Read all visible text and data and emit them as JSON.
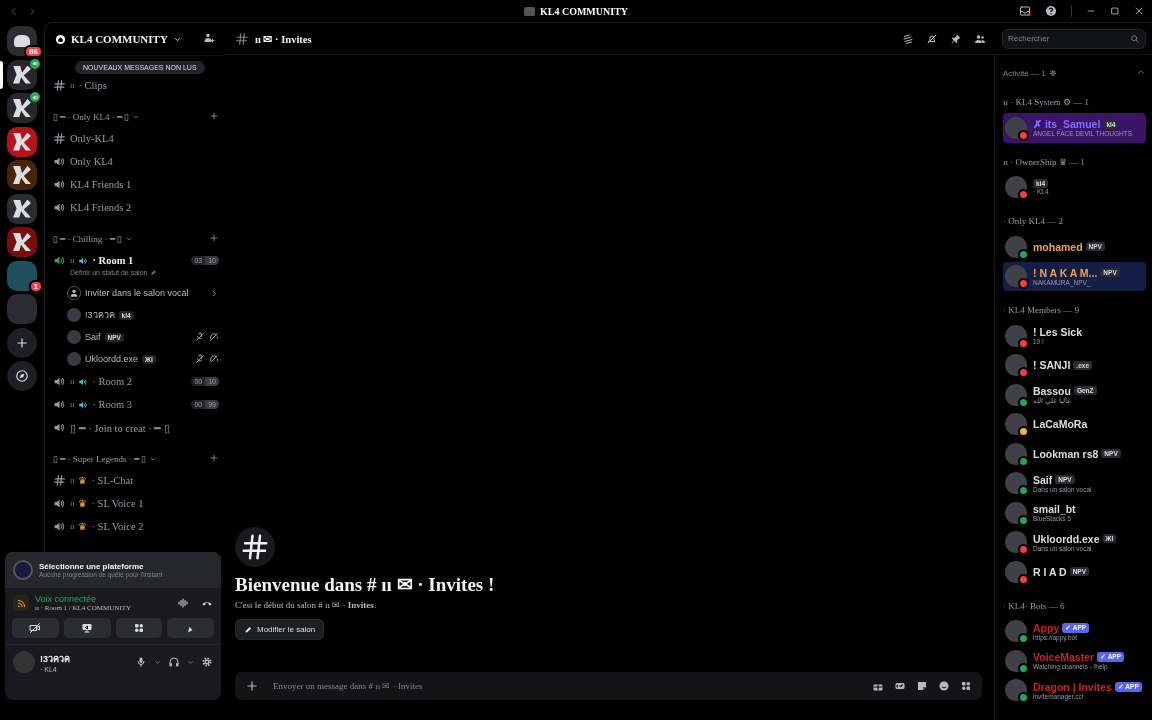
{
  "titlebar": {
    "title": "KL4 COMMUNITY"
  },
  "servers": [
    {
      "kind": "dm",
      "badge": "86",
      "voice": false,
      "selected": false
    },
    {
      "kind": "server",
      "color": "#26262b",
      "voice": true,
      "selected": true
    },
    {
      "kind": "server",
      "color": "#26262b",
      "voice": true,
      "selected": false
    },
    {
      "kind": "server",
      "color": "#b5121b",
      "voice": false,
      "selected": false
    },
    {
      "kind": "server",
      "color": "#4a230c",
      "voice": false,
      "selected": false
    },
    {
      "kind": "server",
      "color": "#2b2d31",
      "voice": false,
      "selected": false
    },
    {
      "kind": "server",
      "color": "#7a0e0e",
      "voice": false,
      "selected": false
    },
    {
      "kind": "folder",
      "color": "#1f4e5f",
      "badge": "1",
      "voice": false,
      "selected": false
    },
    {
      "kind": "folder",
      "color": "#2b2d31",
      "voice": false,
      "selected": false
    },
    {
      "kind": "add",
      "voice": false,
      "selected": false
    },
    {
      "kind": "discover",
      "voice": false,
      "selected": false
    }
  ],
  "channel_panel": {
    "server_name": "KL4 COMMUNITY",
    "unread_pill": "NOUVEAUX MESSAGES NON LUS"
  },
  "channels": [
    {
      "kind": "text",
      "prefix": "ıı",
      "name": "· Clips"
    },
    {
      "kind": "category",
      "label": "▯ ━ · Only KL4 · ━ ▯"
    },
    {
      "kind": "text",
      "name": "Only-KL4"
    },
    {
      "kind": "voice",
      "name": "Only KL4"
    },
    {
      "kind": "voice",
      "name": "KL4 Friends 1"
    },
    {
      "kind": "voice",
      "name": "KL4 Friends 2"
    },
    {
      "kind": "category",
      "label": "▯ ━ · Chilling · ━ ▯"
    },
    {
      "kind": "room",
      "prefix": "ıı",
      "name": "· Room 1",
      "connected": true,
      "users": "03",
      "limit": "10",
      "status": "Définir un statut de salon"
    },
    {
      "kind": "invite",
      "label": "Inviter dans le salon vocal"
    },
    {
      "kind": "voice-user",
      "name": "!3วควค",
      "tag": "kl4",
      "muted": false
    },
    {
      "kind": "voice-user",
      "name": "Saif",
      "tag": "NPV",
      "muted": true
    },
    {
      "kind": "voice-user",
      "name": "Ukloordd.exe",
      "tag": "ЖI",
      "muted": true
    },
    {
      "kind": "room",
      "prefix": "ıı",
      "name": "· Room 2",
      "connected": false,
      "users": "00",
      "limit": "10"
    },
    {
      "kind": "room",
      "prefix": "ıı",
      "name": "· Room 3",
      "connected": false,
      "users": "00",
      "limit": "99"
    },
    {
      "kind": "voice",
      "name": "▯ ━ · Join to creat · ━ ▯"
    },
    {
      "kind": "category",
      "label": "▯ ━ · Super Legends · ━ ▯"
    },
    {
      "kind": "text",
      "prefix": "ıı",
      "emoji": "♛",
      "name": "· SL-Chat"
    },
    {
      "kind": "voice",
      "prefix": "ıı",
      "emoji": "♛",
      "name": "· SL Voice 1"
    },
    {
      "kind": "voice",
      "prefix": "ıı",
      "emoji": "♛",
      "name": "· SL Voice 2"
    }
  ],
  "user_panel": {
    "quest_title": "Sélectionne une plateforme",
    "quest_text": "Aucune progression de quête pour l'instant",
    "voice_status": "Voix connectée",
    "voice_channel": "ıı · Room 1 / KL4 COMMUNITY",
    "user_name": "!3วควค",
    "user_status": "· KL4"
  },
  "chat": {
    "channel_name": "ıı ✉ · Invites",
    "search": {
      "placeholder": "Rechercher"
    },
    "welcome_title": "Bienvenue dans # ıı ✉ · Invites !",
    "welcome_text": "C'est le début du salon # ıı ✉ · **Invites**.",
    "edit_button": "Modifier le salon",
    "composer": {
      "placeholder": "Envoyer un message dans # ıı ✉ · Invites"
    }
  },
  "members": {
    "activity": "Activité — 1",
    "sections": [
      {
        "title": "ıı · KL4 System ⚙ — 1",
        "members": [
          {
            "name": {
              "text": "✗ its_Samuel",
              "color": "#8a6bff"
            },
            "tag": "kl4",
            "sub": "ANGEL FACE DEVIL THOUGHTS",
            "status_dot": {
              "color": "#f23f43"
            },
            "banner": {
              "color": "#3a1466"
            }
          }
        ]
      },
      {
        "title": "ıı · OwnerShip ♛ — 1",
        "members": [
          {
            "tag": "kl4",
            "sub": "· KL4",
            "status_dot": {
              "color": "#f23f43"
            }
          }
        ]
      },
      {
        "title": "· Only KL4 — 2",
        "members": [
          {
            "name": {
              "text": "mohamed",
              "color": "#f0a050"
            },
            "tag": "NPV",
            "status_dot": {
              "color": "#23a55a"
            }
          },
          {
            "name": {
              "text": "! N A K A M...",
              "color": "#f0a050"
            },
            "tag": "NPV",
            "sub": "NAKAMURA_NPV_",
            "status_dot": {
              "color": "#f23f43"
            },
            "banner": {
              "color": "#141e46"
            }
          }
        ]
      },
      {
        "title": "· KL4 Members — 9",
        "members": [
          {
            "name": {
              "text": "! Les Sick",
              "color": "#dbdee1"
            },
            "sub": "19 !",
            "status_dot": {
              "color": "#f23f43"
            }
          },
          {
            "name": {
              "text": "! SANJI",
              "color": "#dbdee1"
            },
            "tag": ".exe",
            "status_dot": {
              "color": "#f23f43"
            }
          },
          {
            "name": {
              "text": "Bassou",
              "color": "#dbdee1"
            },
            "tag": "GenZ",
            "sub": "عاليا علي الله",
            "status_dot": {
              "color": "#23a55a"
            }
          },
          {
            "name": {
              "text": "LaCaMoRa",
              "color": "#dbdee1"
            },
            "status_dot": {
              "color": "#f0b232"
            }
          },
          {
            "name": {
              "text": "Lookman rs8",
              "color": "#dbdee1"
            },
            "tag": "NPV",
            "status_dot": {
              "color": "#23a55a"
            }
          },
          {
            "name": {
              "text": "Saif",
              "color": "#dbdee1"
            },
            "tag": "NPV",
            "sub": "Dans un salon vocal",
            "status_dot": {
              "color": "#23a55a"
            }
          },
          {
            "name": {
              "text": "smail_bt",
              "color": "#dbdee1"
            },
            "sub": "BlueStacks 5",
            "status_dot": {
              "color": "#23a55a"
            }
          },
          {
            "name": {
              "text": "Ukloordd.exe",
              "color": "#dbdee1"
            },
            "tag": "ЖI",
            "sub": "Dans un salon vocal",
            "status_dot": {
              "color": "#f23f43"
            }
          },
          {
            "name": {
              "text": "R I A D",
              "color": "#dbdee1"
            },
            "tag": "NPV",
            "status_dot": {
              "color": "#f23f43"
            }
          }
        ]
      },
      {
        "title": "· KL4· Bots — 6",
        "members": [
          {
            "name": {
              "text": "Appy",
              "color": "#d0202a"
            },
            "tag": "✓ APP",
            "sub": "https://appy.bot",
            "status_dot": {
              "color": "#23a55a"
            }
          },
          {
            "name": {
              "text": "VoiceMaster",
              "color": "#d0202a"
            },
            "tag": "✓ APP",
            "sub": "Watching channels - /help",
            "status_dot": {
              "color": "#23a55a"
            }
          },
          {
            "name": {
              "text": "Dragon | Invites",
              "color": "#d0202a"
            },
            "tag": "✓ APP",
            "sub": "invitemanager.cc!",
            "status_dot": {
              "color": "#23a55a"
            }
          }
        ]
      }
    ]
  }
}
